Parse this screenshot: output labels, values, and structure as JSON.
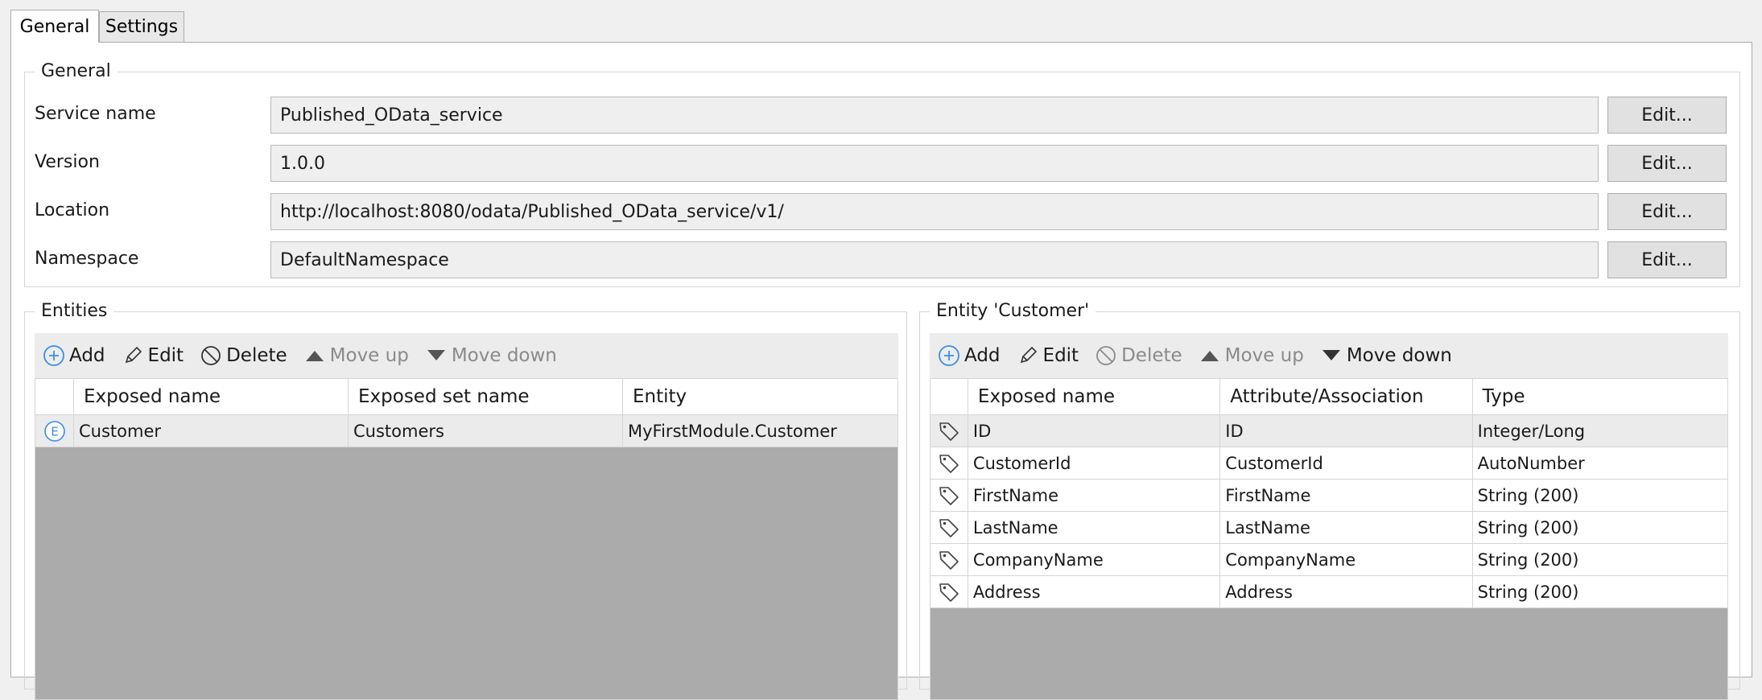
{
  "tabs": {
    "general": "General",
    "settings": "Settings"
  },
  "general_group": {
    "legend": "General",
    "rows": [
      {
        "label": "Service name",
        "value": "Published_OData_service",
        "button": "Edit..."
      },
      {
        "label": "Version",
        "value": "1.0.0",
        "button": "Edit..."
      },
      {
        "label": "Location",
        "value": "http://localhost:8080/odata/Published_OData_service/v1/",
        "button": "Edit..."
      },
      {
        "label": "Namespace",
        "value": "DefaultNamespace",
        "button": "Edit..."
      }
    ]
  },
  "entities": {
    "legend": "Entities",
    "toolbar": {
      "add": "Add",
      "edit": "Edit",
      "delete": "Delete",
      "move_up": "Move up",
      "move_down": "Move down"
    },
    "columns": [
      "Exposed name",
      "Exposed set name",
      "Entity"
    ],
    "rows": [
      {
        "icon": "entity-icon",
        "exposed_name": "Customer",
        "exposed_set_name": "Customers",
        "entity": "MyFirstModule.Customer"
      }
    ]
  },
  "entity_detail": {
    "legend": "Entity 'Customer'",
    "toolbar": {
      "add": "Add",
      "edit": "Edit",
      "delete": "Delete",
      "move_up": "Move up",
      "move_down": "Move down"
    },
    "columns": [
      "Exposed name",
      "Attribute/Association",
      "Type"
    ],
    "rows": [
      {
        "icon": "tag-icon",
        "exposed_name": "ID",
        "attribute": "ID",
        "type": "Integer/Long"
      },
      {
        "icon": "tag-icon",
        "exposed_name": "CustomerId",
        "attribute": "CustomerId",
        "type": "AutoNumber"
      },
      {
        "icon": "tag-icon",
        "exposed_name": "FirstName",
        "attribute": "FirstName",
        "type": "String (200)"
      },
      {
        "icon": "tag-icon",
        "exposed_name": "LastName",
        "attribute": "LastName",
        "type": "String (200)"
      },
      {
        "icon": "tag-icon",
        "exposed_name": "CompanyName",
        "attribute": "CompanyName",
        "type": "String (200)"
      },
      {
        "icon": "tag-icon",
        "exposed_name": "Address",
        "attribute": "Address",
        "type": "String (200)"
      }
    ]
  },
  "colors": {
    "accent": "#3a8ee6",
    "grid_empty": "#ababab"
  }
}
